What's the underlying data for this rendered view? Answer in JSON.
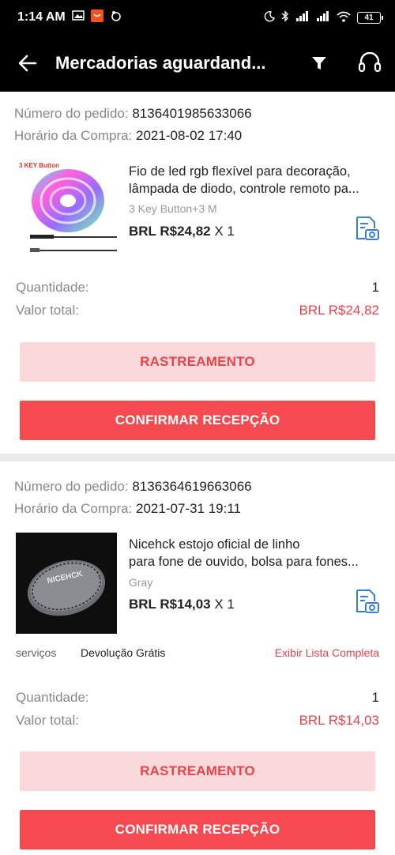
{
  "status_bar": {
    "time": "1:14 AM",
    "battery": "41"
  },
  "header": {
    "title": "Mercadorias aguardand..."
  },
  "labels": {
    "order_number": "Número do pedido:",
    "purchase_time": "Horário da Compra:",
    "quantity": "Quantidade:",
    "total_value": "Valor total:",
    "services": "serviços"
  },
  "orders": [
    {
      "order_number": "8136401985633066",
      "purchase_time": "2021-08-02 17:40",
      "product_title_line1": "Fio de led rgb flexível para decoração,",
      "product_title_line2": "lâmpada de diodo, controle remoto pa...",
      "variant": "3 Key Button+3 M",
      "price": "BRL R$24,82",
      "qty_suffix": "X 1",
      "quantity": "1",
      "total": "BRL R$24,82",
      "thumb_label": "3 KEY Button",
      "track_label": "RASTREAMENTO",
      "confirm_label": "CONFIRMAR RECEPÇÃO"
    },
    {
      "order_number": "8136364619663066",
      "purchase_time": "2021-07-31 19:11",
      "product_title_line1": "Nicehck estojo oficial de linho",
      "product_title_line2": "para fone de ouvido, bolsa para fones...",
      "variant": "Gray",
      "price": "BRL R$14,03",
      "qty_suffix": "X 1",
      "service_value": "Devolução Grátis",
      "service_link": "Exibir Lista Completa",
      "quantity": "1",
      "total": "BRL R$14,03",
      "thumb_label": "NICEHCK",
      "track_label": "RASTREAMENTO",
      "confirm_label": "CONFIRMAR RECEPÇÃO"
    }
  ],
  "colors": {
    "accent": "#f54a50",
    "accent_text": "#e8434a",
    "track_bg": "#fbd8d9",
    "header_bg": "#000000",
    "icon_blue": "#3b7fd4"
  }
}
